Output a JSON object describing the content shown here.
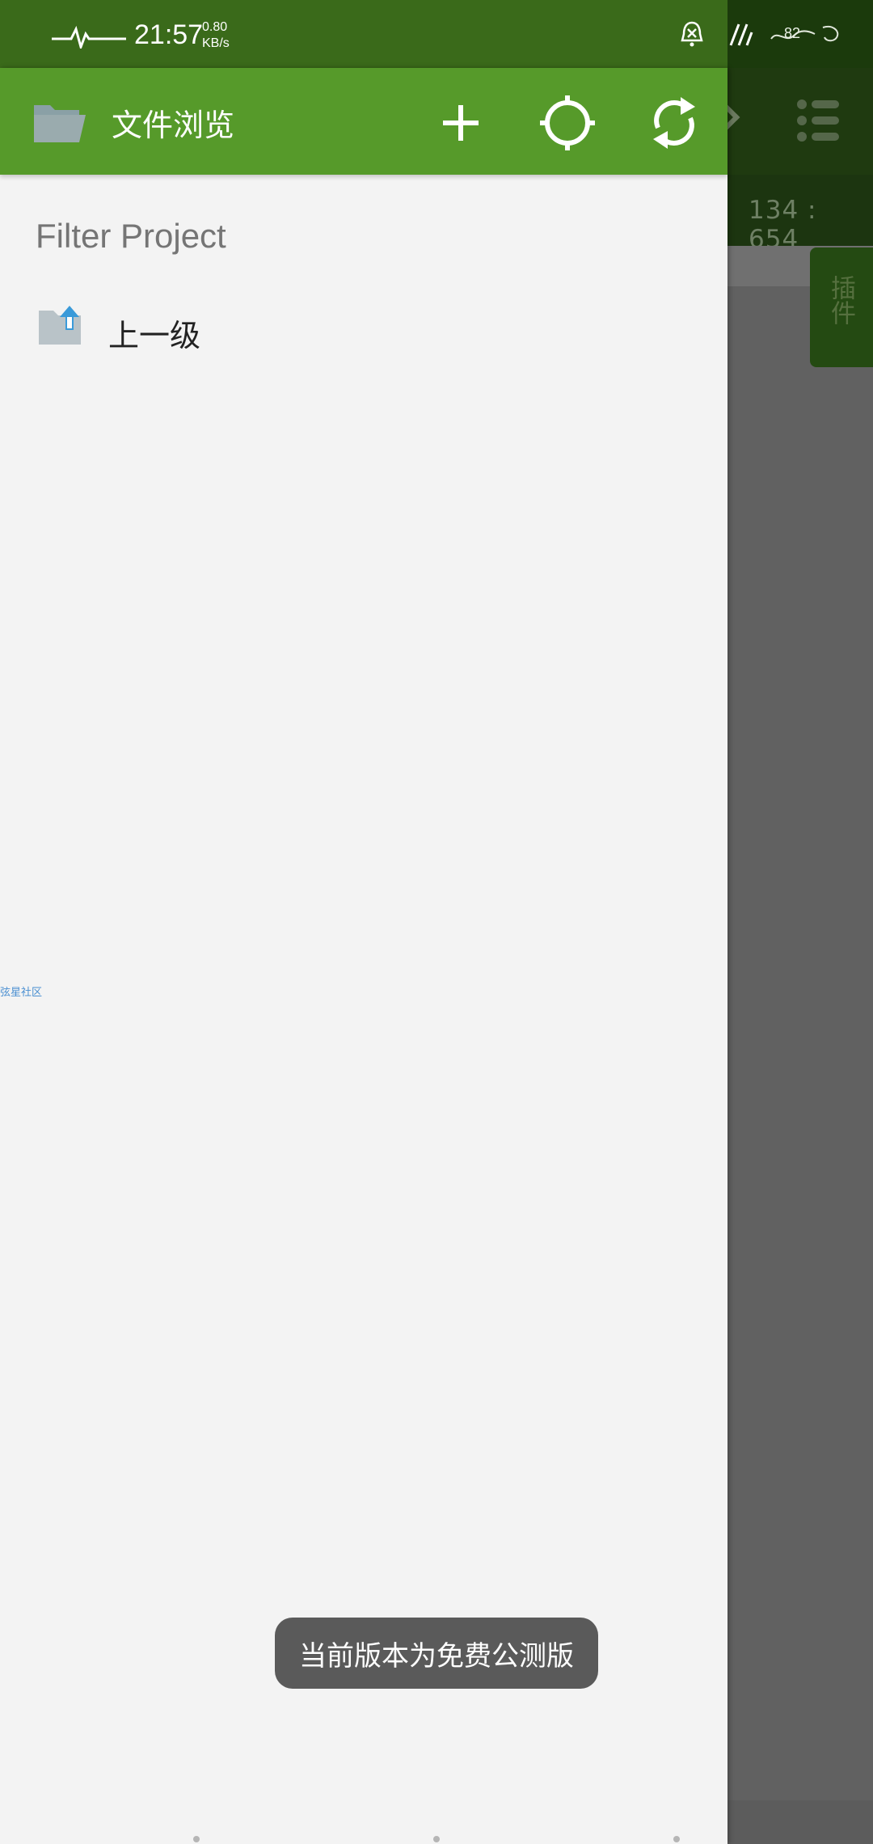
{
  "status_bar": {
    "time": "21:57",
    "speed_value": "0.80",
    "speed_unit": "KB/s",
    "battery": "82",
    "icons": [
      "pulse-icon",
      "alarm-off-icon",
      "signal-icon",
      "battery-icon"
    ]
  },
  "drawer": {
    "title": "文件浏览",
    "actions": [
      "add-icon",
      "locate-icon",
      "refresh-icon"
    ],
    "filter_placeholder": "Filter Project",
    "items": [
      {
        "label": "上一级",
        "icon": "folder-up-icon"
      }
    ],
    "side_watermark": "弦星社区"
  },
  "background": {
    "cursor_position": "134 : 654",
    "plugin_tab": "插件"
  },
  "toast": {
    "message": "当前版本为免费公测版"
  },
  "colors": {
    "header_green": "#569a2a",
    "statusbar_green": "#3a6a1a",
    "drawer_bg": "#f3f3f3",
    "scrim": "#616161",
    "toast_bg": "#5a5a5a"
  }
}
